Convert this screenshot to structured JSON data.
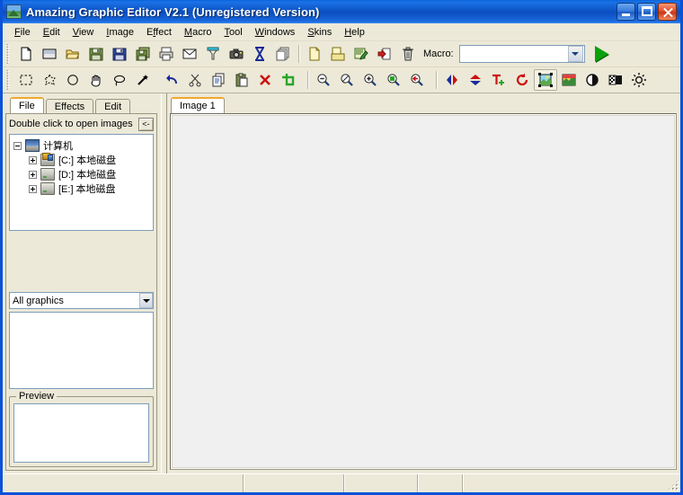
{
  "window": {
    "title": "Amazing Graphic Editor V2.1 (Unregistered Version)",
    "icon": "app-photo-icon",
    "controls": {
      "minimize": "Minimize",
      "maximize": "Maximize",
      "close": "Close"
    }
  },
  "menubar": {
    "items": [
      {
        "label": "File",
        "accel": "F"
      },
      {
        "label": "Edit",
        "accel": "E"
      },
      {
        "label": "View",
        "accel": "V"
      },
      {
        "label": "Image",
        "accel": "I"
      },
      {
        "label": "Effect",
        "accel": "f"
      },
      {
        "label": "Macro",
        "accel": "M"
      },
      {
        "label": "Tool",
        "accel": "T"
      },
      {
        "label": "Windows",
        "accel": "W"
      },
      {
        "label": "Skins",
        "accel": "S"
      },
      {
        "label": "Help",
        "accel": "H"
      }
    ]
  },
  "toolbar_main": {
    "buttons": [
      {
        "name": "new-file-icon",
        "tooltip": "New"
      },
      {
        "name": "new-image-icon",
        "tooltip": "New Image"
      },
      {
        "name": "open-folder-icon",
        "tooltip": "Open"
      },
      {
        "name": "save-icon",
        "tooltip": "Save"
      },
      {
        "name": "save-as-icon",
        "tooltip": "Save As"
      },
      {
        "name": "save-all-icon",
        "tooltip": "Save All"
      },
      {
        "name": "print-icon",
        "tooltip": "Print"
      },
      {
        "name": "mail-icon",
        "tooltip": "Send Mail"
      },
      {
        "name": "screen-capture-icon",
        "tooltip": "Capture"
      },
      {
        "name": "camera-icon",
        "tooltip": "Acquire"
      },
      {
        "name": "hourglass-icon",
        "tooltip": "Batch"
      },
      {
        "name": "duplicate-icon",
        "tooltip": "Duplicate"
      }
    ]
  },
  "toolbar_macro": {
    "buttons": [
      {
        "name": "new-macro-icon",
        "tooltip": "New Macro"
      },
      {
        "name": "open-macro-icon",
        "tooltip": "Open Macro"
      },
      {
        "name": "edit-macro-icon",
        "tooltip": "Edit Macro"
      },
      {
        "name": "apply-macro-icon",
        "tooltip": "Apply Macro"
      },
      {
        "name": "delete-macro-icon",
        "tooltip": "Delete Macro"
      }
    ],
    "label": "Macro:",
    "combo_value": "",
    "combo_placeholder": "",
    "run_button": "run-macro-icon"
  },
  "toolbar_tools": {
    "select_tools": [
      {
        "name": "rect-select-icon",
        "tooltip": "Rectangular Select"
      },
      {
        "name": "polygon-select-icon",
        "tooltip": "Polygon Select"
      },
      {
        "name": "ellipse-select-icon",
        "tooltip": "Ellipse Select"
      },
      {
        "name": "hand-pan-icon",
        "tooltip": "Pan"
      },
      {
        "name": "lasso-select-icon",
        "tooltip": "Lasso Select"
      },
      {
        "name": "magic-wand-icon",
        "tooltip": "Magic Wand"
      }
    ],
    "edit_tools": [
      {
        "name": "undo-icon",
        "tooltip": "Undo"
      },
      {
        "name": "cut-icon",
        "tooltip": "Cut"
      },
      {
        "name": "copy-icon",
        "tooltip": "Copy"
      },
      {
        "name": "paste-icon",
        "tooltip": "Paste"
      },
      {
        "name": "delete-icon",
        "tooltip": "Delete"
      },
      {
        "name": "crop-icon",
        "tooltip": "Crop"
      }
    ],
    "zoom_tools": [
      {
        "name": "zoom-out-icon",
        "tooltip": "Zoom Out"
      },
      {
        "name": "zoom-actual-icon",
        "tooltip": "Actual Size"
      },
      {
        "name": "zoom-in-icon",
        "tooltip": "Zoom In"
      },
      {
        "name": "zoom-fit-icon",
        "tooltip": "Fit to Window"
      },
      {
        "name": "zoom-back-icon",
        "tooltip": "Previous Zoom"
      }
    ],
    "image_tools": [
      {
        "name": "flip-horizontal-icon",
        "tooltip": "Flip Horizontal",
        "active": false
      },
      {
        "name": "flip-vertical-icon",
        "tooltip": "Flip Vertical",
        "active": false
      },
      {
        "name": "add-text-icon",
        "tooltip": "Add Text",
        "active": false
      },
      {
        "name": "rotate-icon",
        "tooltip": "Rotate",
        "active": false
      },
      {
        "name": "resize-image-icon",
        "tooltip": "Resize Image",
        "active": true
      },
      {
        "name": "color-adjust-icon",
        "tooltip": "Adjust Colors",
        "active": false
      },
      {
        "name": "contrast-icon",
        "tooltip": "Contrast",
        "active": false
      },
      {
        "name": "dither-icon",
        "tooltip": "Dither",
        "active": false
      },
      {
        "name": "brightness-icon",
        "tooltip": "Brightness",
        "active": false
      }
    ]
  },
  "sidebar": {
    "tabs": [
      {
        "label": "File",
        "active": true
      },
      {
        "label": "Effects",
        "active": false
      },
      {
        "label": "Edit",
        "active": false
      }
    ],
    "open_hint": "Double click to open images",
    "collapse_button": "<-",
    "tree": [
      {
        "label": "计算机",
        "level": 1,
        "expander": "minus",
        "icon": "computer-icon"
      },
      {
        "label": "[C:] 本地磁盘",
        "level": 2,
        "expander": "plus",
        "icon": "system-drive-icon"
      },
      {
        "label": "[D:] 本地磁盘",
        "level": 2,
        "expander": "plus",
        "icon": "drive-icon"
      },
      {
        "label": "[E:] 本地磁盘",
        "level": 2,
        "expander": "plus",
        "icon": "drive-icon"
      }
    ],
    "filter": {
      "value": "All graphics"
    },
    "file_list": {
      "items": []
    },
    "preview": {
      "title": "Preview",
      "content": ""
    }
  },
  "document": {
    "tabs": [
      {
        "label": "Image 1",
        "active": true
      }
    ],
    "canvas": {
      "content": ""
    }
  },
  "statusbar": {
    "panes": [
      "",
      "",
      "",
      "",
      ""
    ],
    "grip": "resize-grip-icon"
  },
  "colors": {
    "title_blue": "#0a52d8",
    "face": "#ece9d8",
    "active_tab_accent": "#f0a830",
    "close_red": "#c93716",
    "run_green": "#0ba10b",
    "canvas": "#f0f0f0"
  }
}
